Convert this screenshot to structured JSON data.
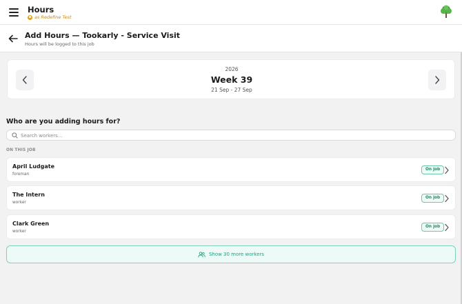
{
  "app": {
    "title": "Hours",
    "acting_as": "as Redefine Test",
    "menu_icon": "hamburger-menu-icon",
    "logo_icon": "tree-logo-icon"
  },
  "subheader": {
    "title": "Add Hours — Tookarly - Service Visit",
    "caption": "Hours will be logged to this job",
    "back_icon": "arrow-left-icon"
  },
  "week": {
    "year": "2026",
    "label": "Week 39",
    "range": "21 Sep - 27 Sep",
    "prev_icon": "chevron-left-icon",
    "next_icon": "chevron-right-icon"
  },
  "workers_section": {
    "question": "Who are you adding hours for?",
    "search_placeholder": "Search workers...",
    "search_value": "",
    "group_label": "ON THIS JOB",
    "items": [
      {
        "name": "April Ludgate",
        "role": "foreman",
        "badge": "On job"
      },
      {
        "name": "The Intern",
        "role": "worker",
        "badge": "On job"
      },
      {
        "name": "Clark Green",
        "role": "worker",
        "badge": "On job"
      }
    ],
    "show_more_label": "Show 30 more workers",
    "show_more_icon": "people-icon"
  },
  "colors": {
    "accent": "#22a07f",
    "badge_border": "#6cc8a8",
    "user_badge": "#e3a21a",
    "background": "#f2f2f3"
  }
}
